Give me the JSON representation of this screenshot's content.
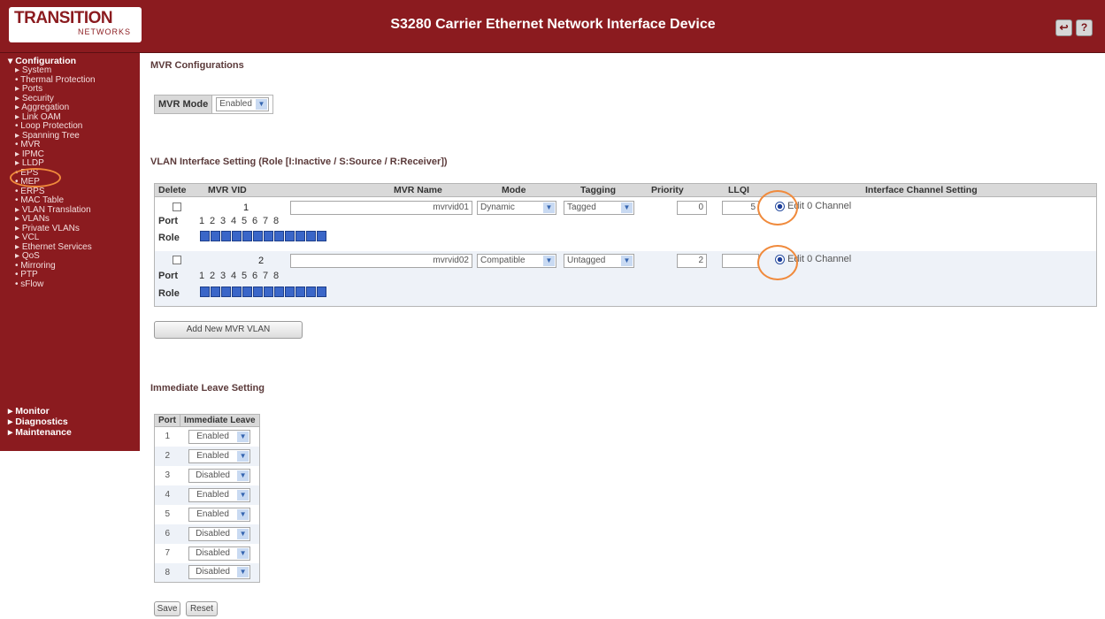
{
  "header": {
    "logo_line1": "TRANSITION",
    "logo_line2": "NETWORKS",
    "title": "S3280 Carrier Ethernet Network Interface Device",
    "icons": [
      "logout-icon",
      "help-icon"
    ]
  },
  "sidebar": {
    "configuration": "Configuration",
    "items": [
      "System",
      "Thermal Protection",
      "Ports",
      "Security",
      "Aggregation",
      "Link OAM",
      "Loop Protection",
      "Spanning Tree",
      "MVR",
      "IPMC",
      "LLDP",
      "EPS",
      "MEP",
      "ERPS",
      "MAC Table",
      "VLAN Translation",
      "VLANs",
      "Private VLANs",
      "VCL",
      "Ethernet Services",
      "QoS",
      "Mirroring",
      "PTP",
      "sFlow"
    ],
    "monitor": "Monitor",
    "diagnostics": "Diagnostics",
    "maintenance": "Maintenance"
  },
  "mvr": {
    "heading": "MVR Configurations",
    "mode_label": "MVR Mode",
    "mode_value": "Enabled"
  },
  "vlan": {
    "heading": "VLAN Interface Setting (Role [I:Inactive / S:Source / R:Receiver])",
    "columns": [
      "Delete",
      "MVR VID",
      "MVR Name",
      "Mode",
      "Tagging",
      "Priority",
      "LLQI",
      "Interface Channel Setting"
    ],
    "port_label": "Port",
    "role_label": "Role",
    "ports": [
      "1",
      "2",
      "3",
      "4",
      "5",
      "6",
      "7",
      "8"
    ],
    "rows": [
      {
        "vid": "1",
        "name": "mvrvid01",
        "mode": "Dynamic",
        "tagging": "Tagged",
        "priority": "0",
        "llqi": "5",
        "channel": "Edit 0 Channel"
      },
      {
        "vid": "2",
        "name": "mvrvid02",
        "mode": "Compatible",
        "tagging": "Untagged",
        "priority": "2",
        "llqi": "",
        "channel": "Edit 0 Channel"
      }
    ],
    "add_button": "Add New MVR VLAN"
  },
  "immediate": {
    "heading": "Immediate Leave Setting",
    "columns": [
      "Port",
      "Immediate Leave"
    ],
    "rows": [
      {
        "port": "1",
        "value": "Enabled"
      },
      {
        "port": "2",
        "value": "Enabled"
      },
      {
        "port": "3",
        "value": "Disabled"
      },
      {
        "port": "4",
        "value": "Enabled"
      },
      {
        "port": "5",
        "value": "Enabled"
      },
      {
        "port": "6",
        "value": "Disabled"
      },
      {
        "port": "7",
        "value": "Disabled"
      },
      {
        "port": "8",
        "value": "Disabled"
      }
    ]
  },
  "buttons": {
    "save": "Save",
    "reset": "Reset"
  },
  "colors": {
    "brand": "#8b1b1f",
    "highlight": "#f08a3c",
    "role": "#3a66c8"
  }
}
